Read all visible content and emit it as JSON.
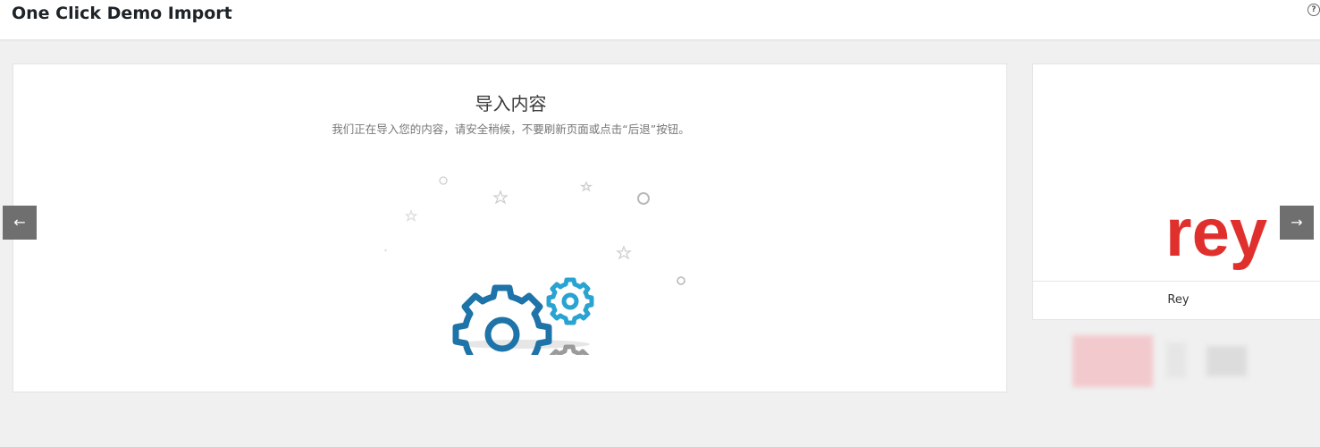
{
  "app": {
    "title": "One Click Demo Import",
    "help_icon_glyph": "?"
  },
  "main": {
    "heading": "导入内容",
    "subheading": "我们正在导入您的内容，请安全稍候，不要刷新页面或点击“后退”按钮。",
    "illustration": {
      "icon": "gears-illustration",
      "colors": {
        "large_gear": "#1e73a8",
        "small_gear": "#29a3d1",
        "grey_gear": "#9b9b9b"
      }
    }
  },
  "carousel": {
    "prev_glyph": "←",
    "next_glyph": "→",
    "side_item": {
      "logo_text": "rey",
      "logo_color": "#e0302e",
      "label": "Rey"
    }
  }
}
